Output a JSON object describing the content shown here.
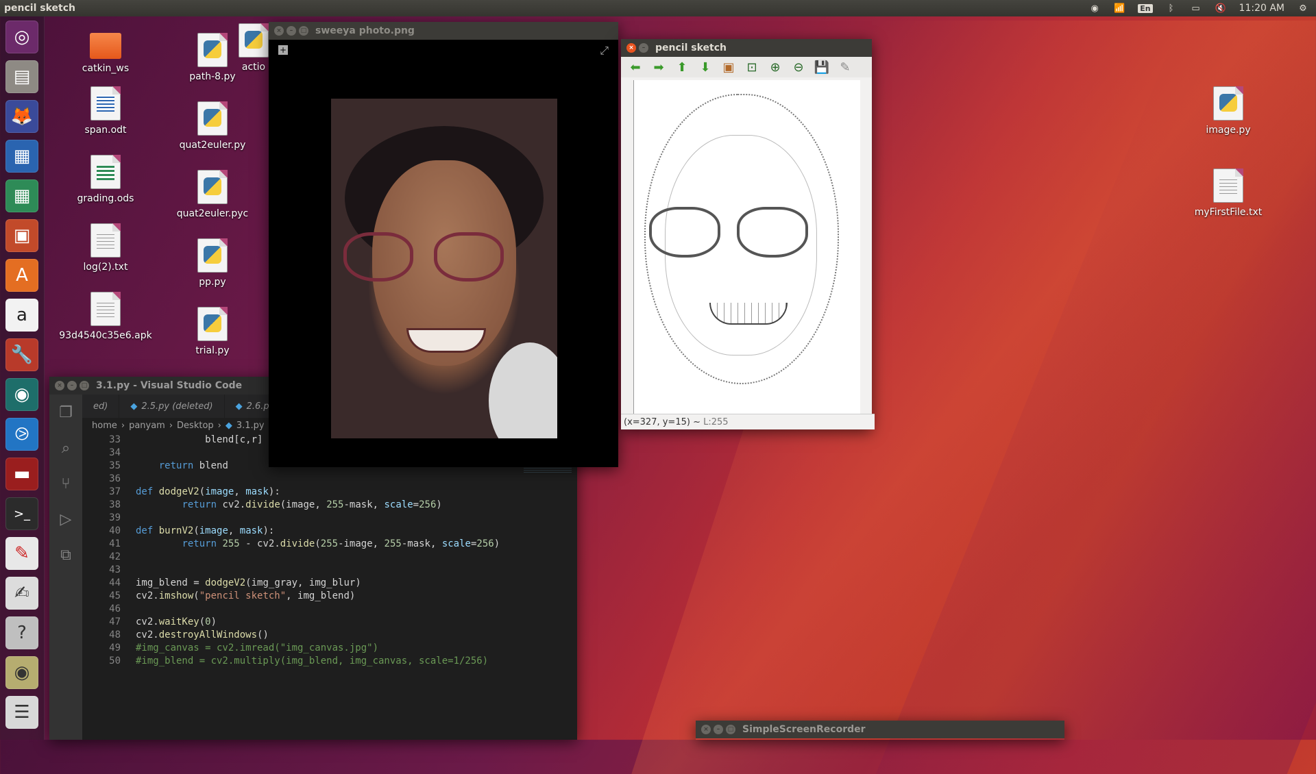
{
  "topbar": {
    "active_title": "pencil sketch",
    "lang": "En",
    "clock": "11:20 AM"
  },
  "launcher": {
    "items": [
      "ubuntu-dash",
      "files",
      "firefox",
      "writer",
      "calc",
      "impress",
      "software-center",
      "amazon",
      "system-settings",
      "browser",
      "vscode",
      "app-red",
      "terminal",
      "app-pencil",
      "text-editor",
      "help",
      "app-eye",
      "workspaces"
    ]
  },
  "desktop": {
    "icons": [
      {
        "label": "catkin_ws",
        "kind": "folder"
      },
      {
        "label": "span.odt",
        "kind": "writer"
      },
      {
        "label": "grading.ods",
        "kind": "sheet"
      },
      {
        "label": "log(2).txt",
        "kind": "text"
      },
      {
        "label": "93d4540c35e6.apk",
        "kind": "text"
      },
      {
        "label": "path-8.py",
        "kind": "python"
      },
      {
        "label": "quat2euler.py",
        "kind": "python"
      },
      {
        "label": "quat2euler.pyc",
        "kind": "python"
      },
      {
        "label": "pp.py",
        "kind": "python"
      },
      {
        "label": "trial.py",
        "kind": "python"
      },
      {
        "label": "actio",
        "kind": "python"
      },
      {
        "label": "image.py",
        "kind": "python"
      },
      {
        "label": "myFirstFile.txt",
        "kind": "text"
      }
    ]
  },
  "vscode": {
    "title": "3.1.py - Visual Studio Code",
    "tabs": [
      "ed)",
      "2.5.py (deleted)",
      "2.6.py"
    ],
    "breadcrumb": [
      "home",
      "panyam",
      "Desktop",
      "3.1.py",
      "..."
    ],
    "lines": [
      {
        "n": "33",
        "html": "            blend[c,r] = t"
      },
      {
        "n": "34",
        "html": ""
      },
      {
        "n": "35",
        "html": "    <span class=\"kw\">return</span> blend"
      },
      {
        "n": "36",
        "html": ""
      },
      {
        "n": "37",
        "html": "<span class=\"kw\">def</span> <span class=\"fn\">dodgeV2</span>(<span class=\"pm\">image</span>, <span class=\"pm\">mask</span>):"
      },
      {
        "n": "38",
        "html": "        <span class=\"kw\">return</span> cv2.<span class=\"fn\">divide</span>(image, <span class=\"num\">255</span>-mask, <span class=\"pm\">scale</span>=<span class=\"num\">256</span>)"
      },
      {
        "n": "39",
        "html": ""
      },
      {
        "n": "40",
        "html": "<span class=\"kw\">def</span> <span class=\"fn\">burnV2</span>(<span class=\"pm\">image</span>, <span class=\"pm\">mask</span>):"
      },
      {
        "n": "41",
        "html": "        <span class=\"kw\">return</span> <span class=\"num\">255</span> - cv2.<span class=\"fn\">divide</span>(<span class=\"num\">255</span>-image, <span class=\"num\">255</span>-mask, <span class=\"pm\">scale</span>=<span class=\"num\">256</span>)"
      },
      {
        "n": "42",
        "html": ""
      },
      {
        "n": "43",
        "html": ""
      },
      {
        "n": "44",
        "html": "img_blend = <span class=\"fn\">dodgeV2</span>(img_gray, img_blur)"
      },
      {
        "n": "45",
        "html": "cv2.<span class=\"fn\">imshow</span>(<span class=\"str\">\"pencil sketch\"</span>, img_blend)"
      },
      {
        "n": "46",
        "html": ""
      },
      {
        "n": "47",
        "html": "cv2.<span class=\"fn\">waitKey</span>(<span class=\"num\">0</span>)"
      },
      {
        "n": "48",
        "html": "cv2.<span class=\"fn\">destroyAllWindows</span>()"
      },
      {
        "n": "49",
        "html": "<span class=\"com\">#img_canvas = cv2.imread(\"img_canvas.jpg\")</span>"
      },
      {
        "n": "50",
        "html": "<span class=\"com\">#img_blend = cv2.multiply(img_blend, img_canvas, scale=1/256)</span>"
      }
    ]
  },
  "photo_viewer": {
    "title": "sweeya photo.png"
  },
  "sketch": {
    "title": "pencil sketch",
    "status_coords": "(x=327, y=15) ~",
    "status_value": "L:255"
  },
  "ssr": {
    "title": "SimpleScreenRecorder"
  }
}
